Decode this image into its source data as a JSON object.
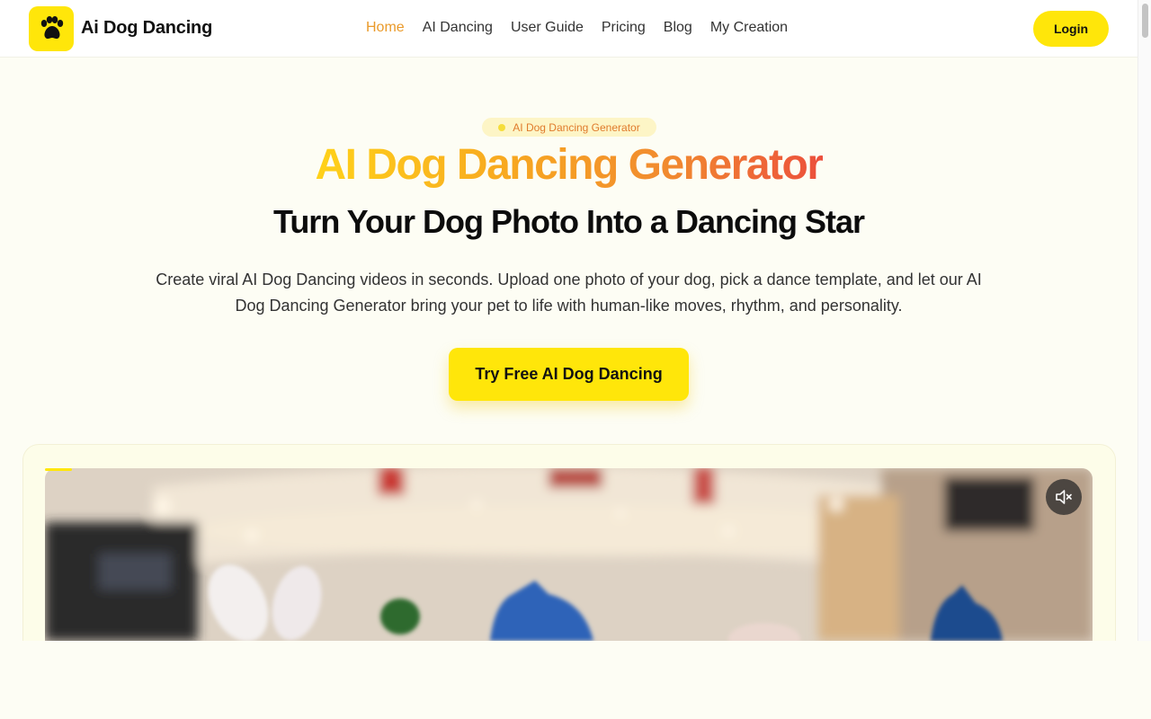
{
  "header": {
    "brand": "Ai Dog Dancing",
    "nav": [
      {
        "label": "Home",
        "active": true
      },
      {
        "label": "AI Dancing",
        "active": false
      },
      {
        "label": "User Guide",
        "active": false
      },
      {
        "label": "Pricing",
        "active": false
      },
      {
        "label": "Blog",
        "active": false
      },
      {
        "label": "My Creation",
        "active": false
      }
    ],
    "login_label": "Login"
  },
  "hero": {
    "badge": "AI Dog Dancing Generator",
    "title": "AI Dog Dancing Generator",
    "subtitle": "Turn Your Dog Photo Into a Dancing Star",
    "description": "Create viral AI Dog Dancing videos in seconds. Upload one photo of your dog, pick a dance template, and let our AI Dog Dancing Generator bring your pet to life with human-like moves, rhythm, and personality.",
    "cta_label": "Try Free AI Dog Dancing"
  },
  "video": {
    "mute_icon": "muted-speaker-icon"
  },
  "colors": {
    "accent_yellow": "#ffe60a",
    "nav_active": "#ea9a2a",
    "gradient_start": "#ffd21a",
    "gradient_end": "#ec4f3c"
  }
}
